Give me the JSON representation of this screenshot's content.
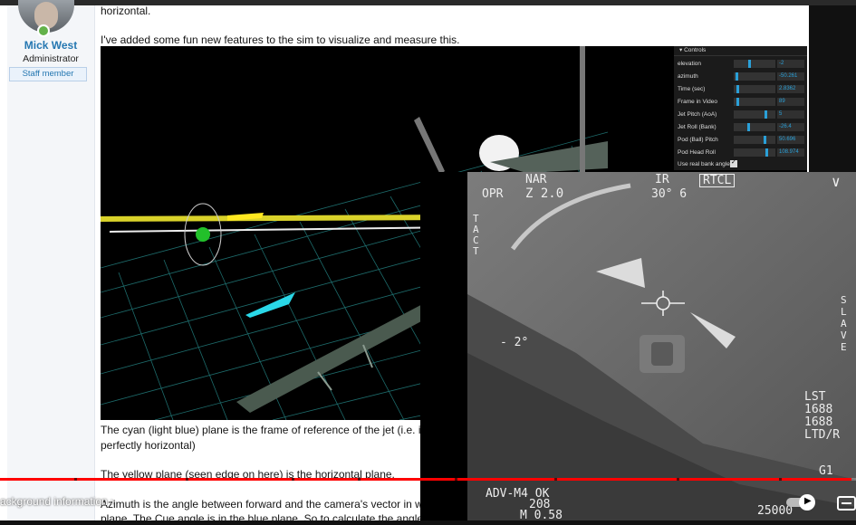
{
  "forum": {
    "user": {
      "name": "Mick West",
      "role": "Administrator",
      "badge": "Staff member"
    },
    "post": {
      "line_top": "horizontal.",
      "line_intro": "I've added some fun new features to the sim to visualize and measure this.",
      "para_cyan_1": "The cyan (light blue) plane is the frame of reference of the jet (i.e. it's",
      "para_cyan_2": "perfectly horizontal)",
      "para_yellow": "The yellow plane (seen edge on here) is the horizontal plane.",
      "para_bottom_1": "Azimuth is the angle between forward and the camera's vector in wh",
      "para_bottom_2": "plane. The Cue angle is in the blue plane. So to calculate the angles"
    }
  },
  "sim_controls": {
    "title": "Controls",
    "rows": [
      {
        "label": "elevation",
        "value": "-2",
        "pos": 0.38
      },
      {
        "label": "azimuth",
        "value": "-50.261",
        "pos": 0.05
      },
      {
        "label": "Time (sec)",
        "value": "2.8362",
        "pos": 0.06
      },
      {
        "label": "Frame in Video",
        "value": "89",
        "pos": 0.06
      },
      {
        "label": "Jet Pitch (AoA)",
        "value": "5",
        "pos": 0.78
      },
      {
        "label": "Jet Roll (Bank)",
        "value": "-26.4",
        "pos": 0.36
      },
      {
        "label": "Pod (Ball) Pitch",
        "value": "50.696",
        "pos": 0.76
      },
      {
        "label": "Pod Head Roll",
        "value": "108.974",
        "pos": 0.81
      }
    ],
    "checkbox_label": "Use real bank angle",
    "checkbox_checked": true
  },
  "flir_overlay": {
    "nar": "NAR",
    "zoom": "Z 2.0",
    "opr": "OPR",
    "ir": "IR",
    "heading": "30° 6",
    "mode_box": "RTCL",
    "tact": "TACT",
    "slave": "SLAVE",
    "elevation": "- 2°",
    "lst": "LST",
    "lst_1": "1688",
    "lst_2": "1688",
    "ltd": "LTD/R",
    "g1": "G1",
    "adv": "ADV-M4 OK",
    "line2": "208",
    "line3": "M 0.58",
    "bottom_right": "25000"
  },
  "player": {
    "chapter_title": "ackground information",
    "progress": 0.995,
    "colors": {
      "progress": "#ff0000",
      "link": "#2577b1"
    }
  }
}
